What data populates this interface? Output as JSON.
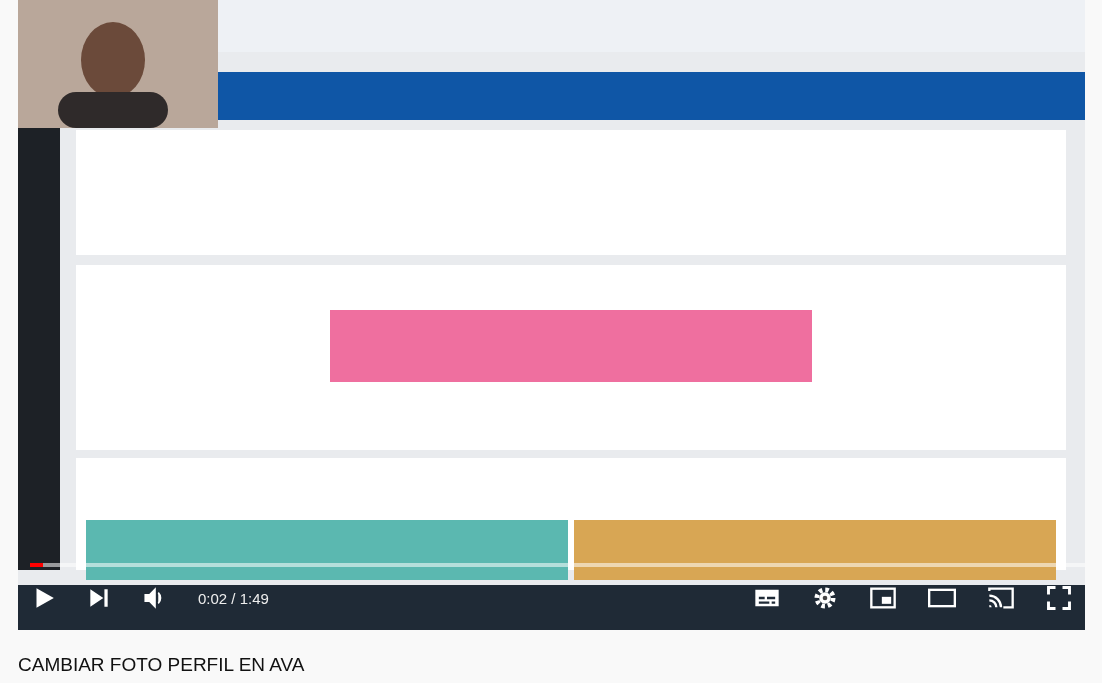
{
  "video": {
    "kind": "picture",
    "progress": {
      "level": 0.012
    },
    "time": "0:02 / 1:49"
  },
  "title": "CAMBIAR FOTO PERFIL EN AVA"
}
